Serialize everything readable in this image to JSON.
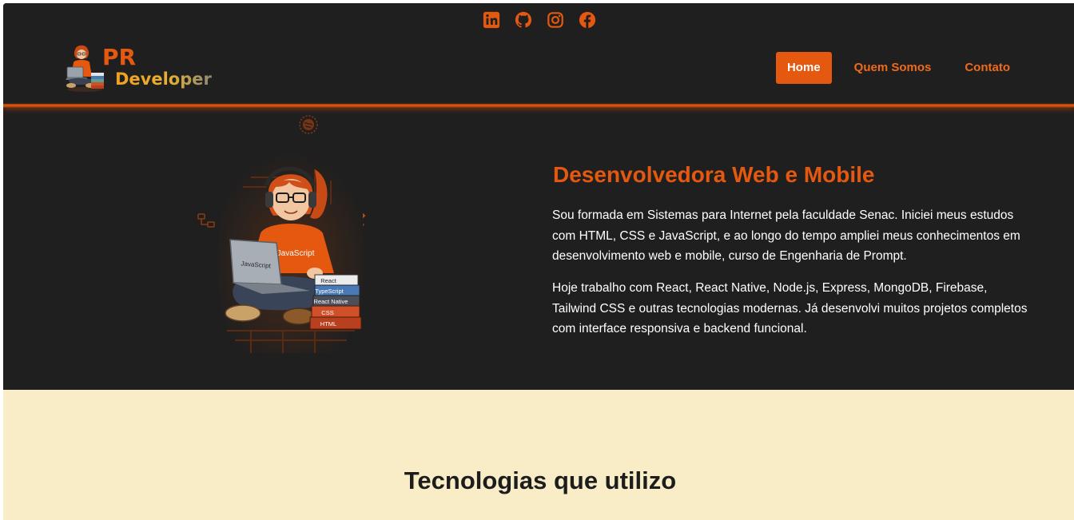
{
  "header": {
    "social": [
      {
        "icon": "linkedin-icon"
      },
      {
        "icon": "github-icon"
      },
      {
        "icon": "instagram-icon"
      },
      {
        "icon": "facebook-icon"
      }
    ],
    "logo": {
      "line1": "PR",
      "line2": "Developer"
    },
    "nav": [
      {
        "label": "Home",
        "active": true
      },
      {
        "label": "Quem Somos",
        "active": false
      },
      {
        "label": "Contato",
        "active": false
      }
    ]
  },
  "hero": {
    "title": "Desenvolvedora Web e Mobile",
    "paragraphs": [
      "Sou formada em Sistemas para Internet pela faculdade Senac. Iniciei meus estudos com HTML, CSS e JavaScript, e ao longo do tempo ampliei meus conhecimentos em desenvolvimento web e mobile, curso de Engenharia de Prompt.",
      "Hoje trabalho com React, React Native, Node.js, Express, MongoDB, Firebase, Tailwind CSS e outras tecnologias modernas. Já desenvolvi muitos projetos completos com interface responsiva e backend funcional."
    ],
    "illustration": {
      "shirt_text": "JavaScript",
      "laptop_text": "JavaScript",
      "books": [
        "React",
        "TypeScript",
        "React Native",
        "CSS",
        "HTML"
      ]
    }
  },
  "tech": {
    "title": "Tecnologias que utilizo"
  },
  "colors": {
    "accent": "#e4580f",
    "background_dark": "#201f1f",
    "section_light": "#f8edc6",
    "text_light": "#ffffff"
  }
}
